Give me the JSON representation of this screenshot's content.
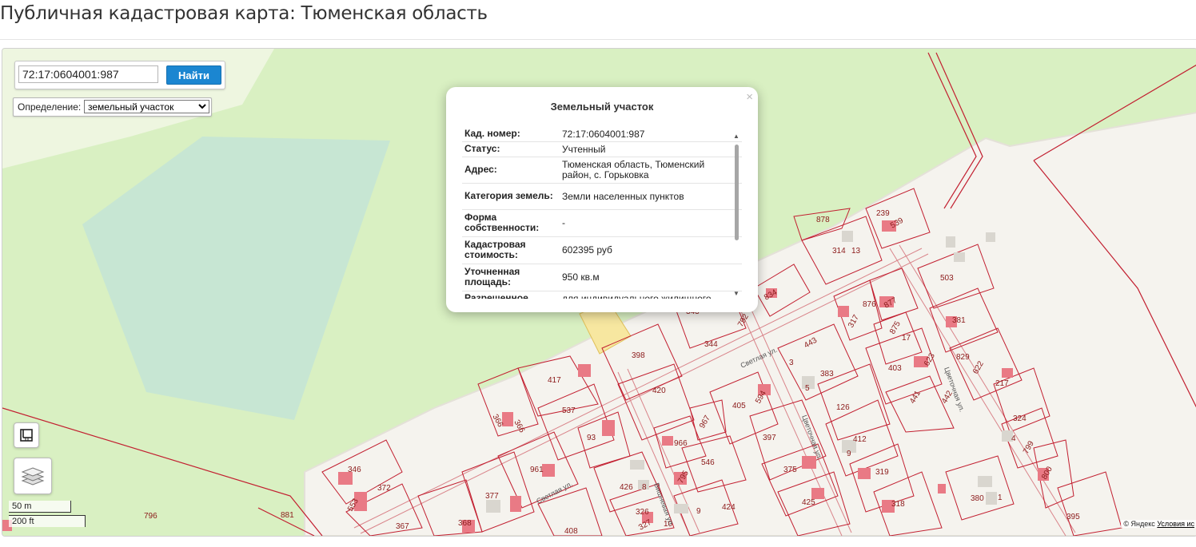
{
  "page": {
    "title": "Публичная кадастровая карта: Тюменская область"
  },
  "search": {
    "value": "72:17:0604001:987",
    "button_label": "Найти"
  },
  "definition": {
    "label": "Определение:",
    "selected": "земельный участок"
  },
  "popup": {
    "title": "Земельный участок",
    "close_symbol": "×",
    "rows": [
      {
        "label": "Кад. номер:",
        "value": "72:17:0604001:987"
      },
      {
        "label": "Статус:",
        "value": "Учтенный"
      },
      {
        "label": "Адрес:",
        "value": "Тюменская область, Тюменский район, с. Горьковка"
      },
      {
        "label": "Категория земель:",
        "value": "Земли населенных пунктов"
      },
      {
        "label": "Форма собственности:",
        "value": "-"
      },
      {
        "label": "Кадастровая стоимость:",
        "value": "602395 руб"
      },
      {
        "label": "Уточненная площадь:",
        "value": "950 кв.м"
      },
      {
        "label": "Разрешенное",
        "value": "для индивидуального жилищного"
      }
    ]
  },
  "scale": {
    "metric": "50 m",
    "imperial": "200 ft"
  },
  "copyright": {
    "text": "© Яндекс",
    "link": "Условия ис"
  },
  "map": {
    "plot_numbers": [
      "878",
      "239",
      "539",
      "314",
      "13",
      "834",
      "343",
      "792",
      "344",
      "503",
      "876",
      "877",
      "317",
      "381",
      "875",
      "443",
      "829",
      "622",
      "217",
      "403",
      "623",
      "3",
      "383",
      "398",
      "5",
      "420",
      "417",
      "537",
      "366",
      "366",
      "93",
      "405",
      "594",
      "397",
      "126",
      "441",
      "442",
      "324",
      "967",
      "966",
      "546",
      "412",
      "9",
      "4",
      "799",
      "800",
      "346",
      "372",
      "553",
      "377",
      "961",
      "426",
      "8",
      "795",
      "375",
      "319",
      "380",
      "1",
      "318",
      "425",
      "424",
      "9",
      "326",
      "327",
      "10",
      "408",
      "368",
      "367",
      "881",
      "796",
      "395",
      "17"
    ],
    "streets": [
      "Светлая ул.",
      "Цветочная ул.",
      "Цветочная ул.",
      "Вишневая ул.",
      "Светлая ул."
    ]
  },
  "icons": {
    "ruler": "ruler-icon",
    "layers": "layers-icon"
  }
}
